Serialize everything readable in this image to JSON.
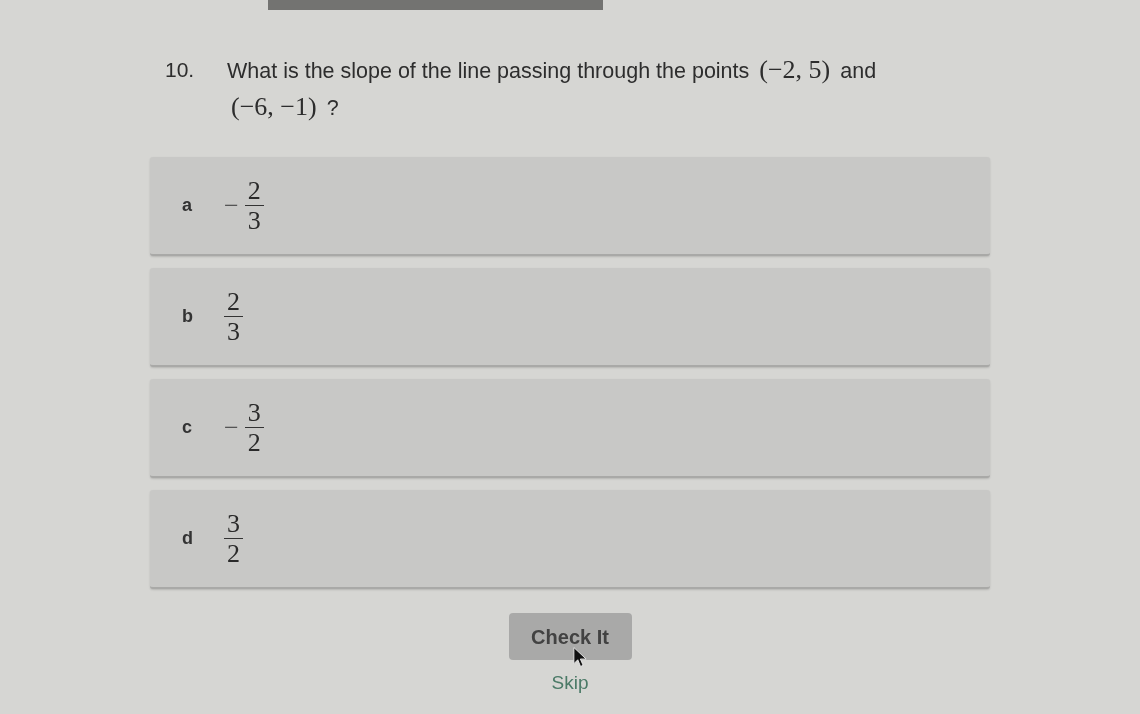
{
  "question": {
    "number": "10.",
    "parts": [
      {
        "kind": "text",
        "text": "What is the slope of the line passing through the points"
      },
      {
        "kind": "math",
        "text": "(−2, 5)"
      },
      {
        "kind": "text",
        "text": "and"
      },
      {
        "kind": "math",
        "text": "(−6, −1)"
      },
      {
        "kind": "text",
        "text": "?"
      }
    ]
  },
  "options": [
    {
      "letter": "a",
      "sign": "−",
      "numerator": "2",
      "denominator": "3",
      "selected": false
    },
    {
      "letter": "b",
      "numerator": "2",
      "denominator": "3",
      "selected": false
    },
    {
      "letter": "c",
      "sign": "−",
      "numerator": "3",
      "denominator": "2",
      "selected": false
    },
    {
      "letter": "d",
      "numerator": "3",
      "denominator": "2",
      "selected": false
    }
  ],
  "check_button": {
    "label": "Check It"
  },
  "skip_link": {
    "label": "Skip"
  }
}
